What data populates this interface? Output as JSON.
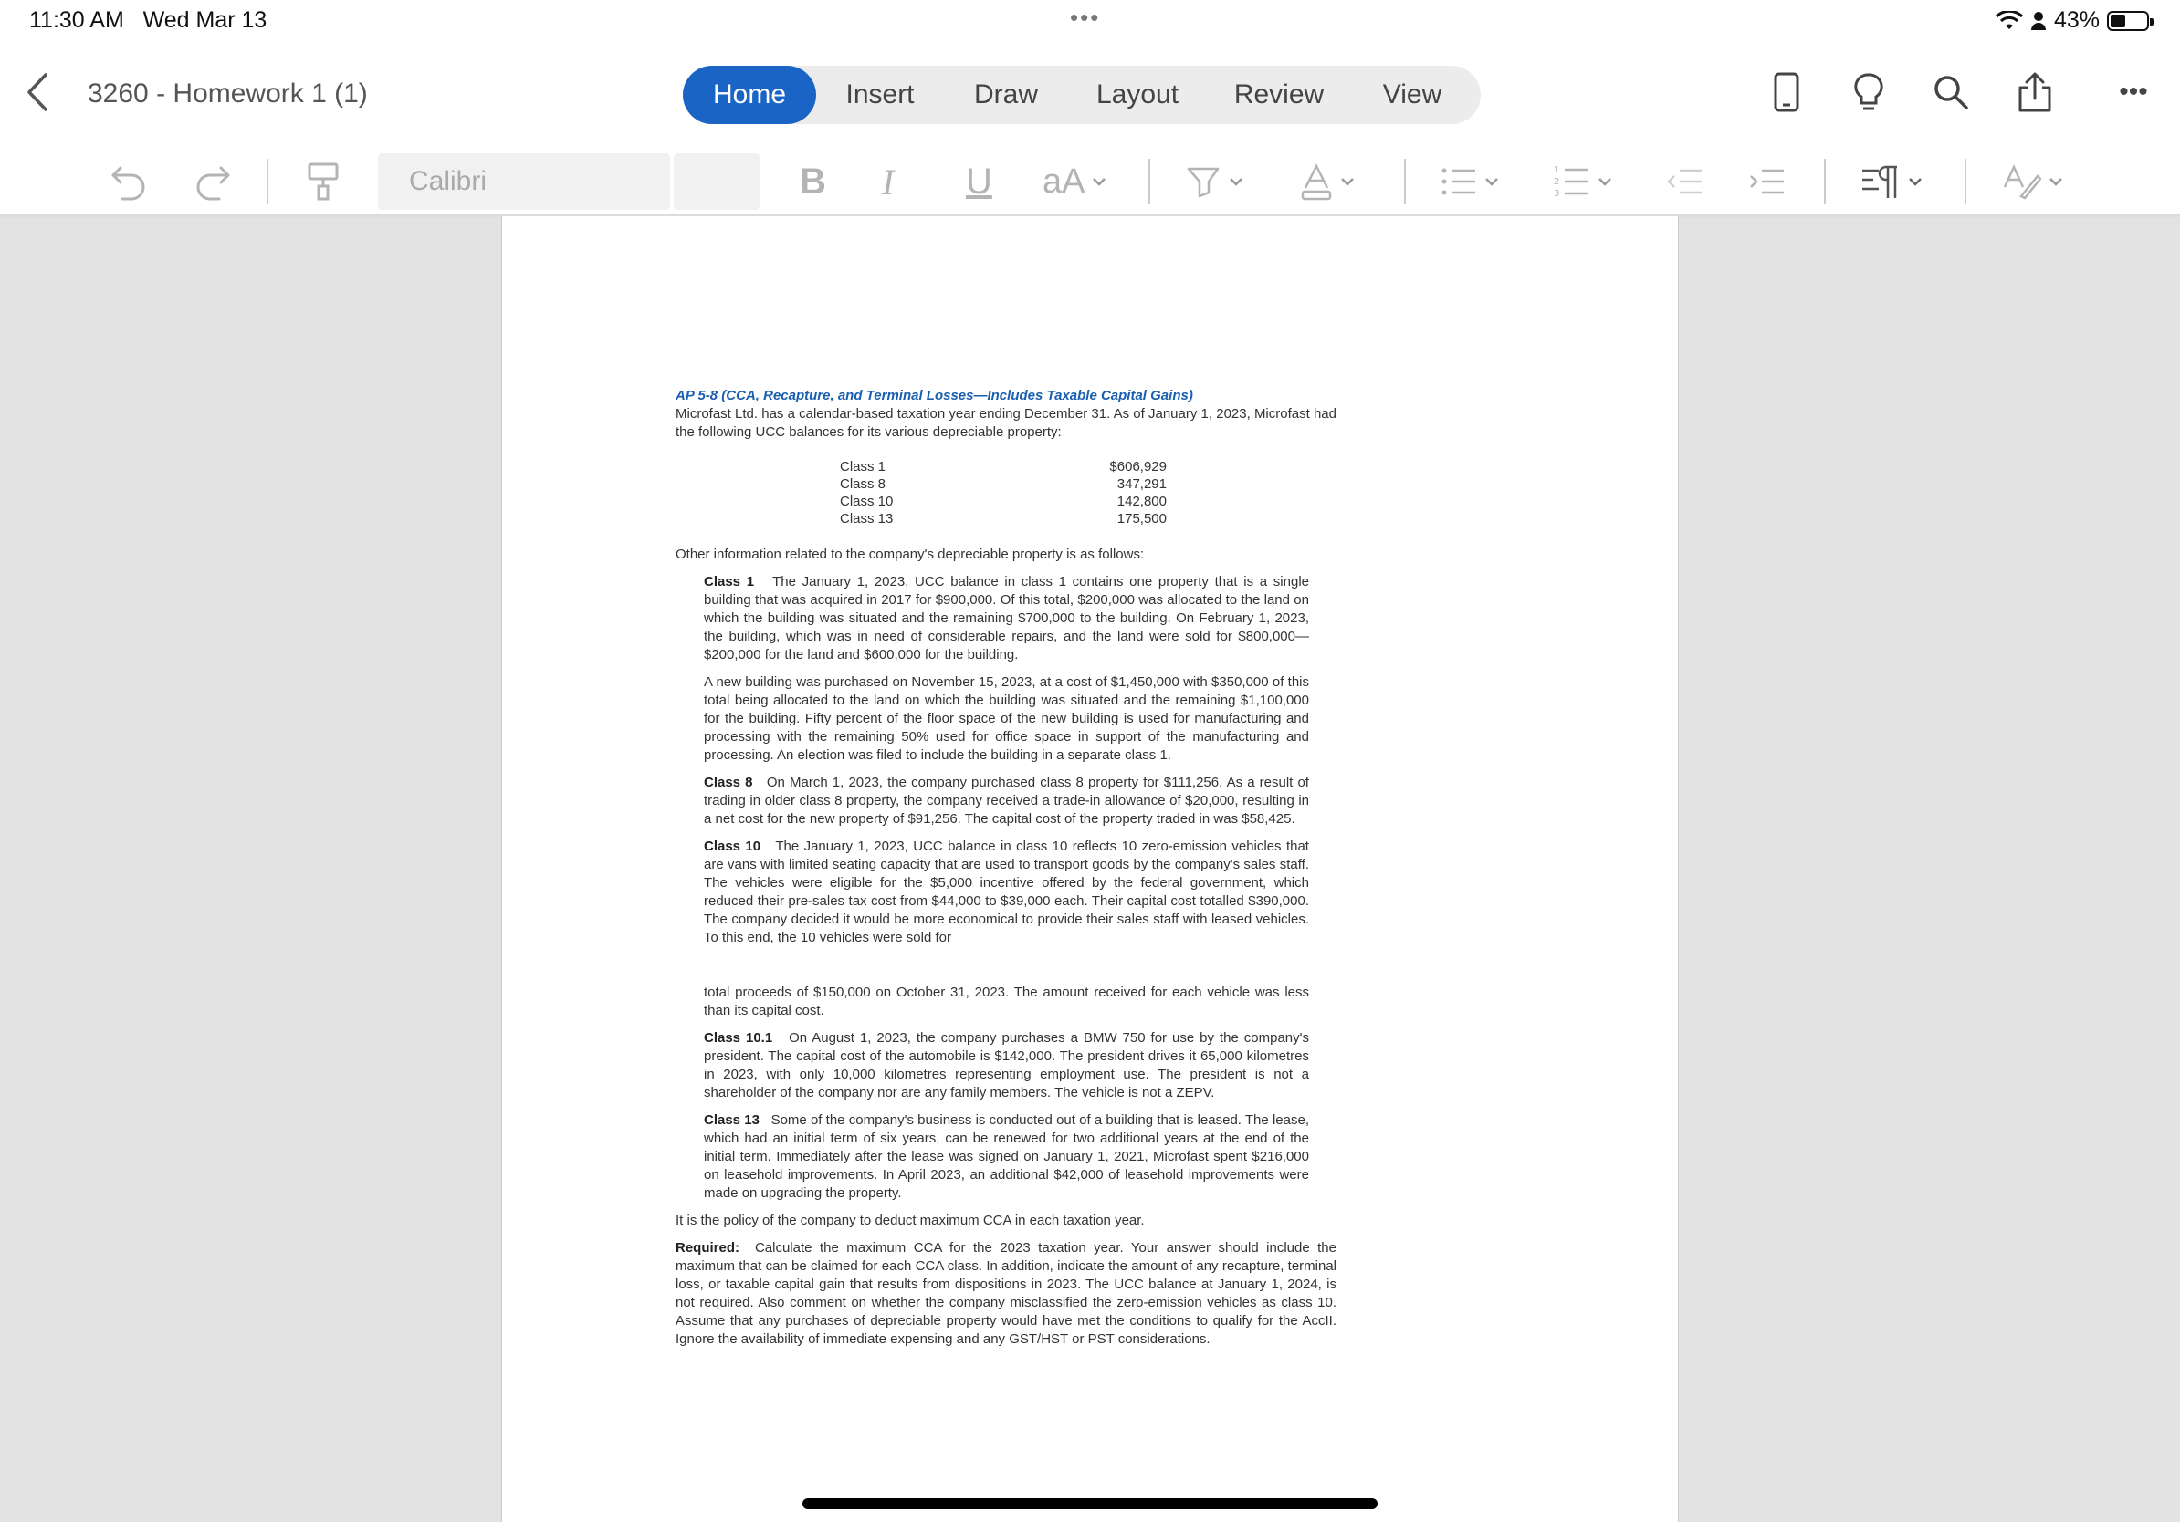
{
  "status": {
    "time": "11:30 AM",
    "date": "Wed Mar 13",
    "dots": "•••",
    "battery": "43%",
    "battery_level": 0.43
  },
  "titlebar": {
    "title": "3260 - Homework 1 (1)",
    "tabs": [
      {
        "label": "Home",
        "active": true
      },
      {
        "label": "Insert",
        "active": false
      },
      {
        "label": "Draw",
        "active": false
      },
      {
        "label": "Layout",
        "active": false
      },
      {
        "label": "Review",
        "active": false
      },
      {
        "label": "View",
        "active": false
      }
    ],
    "more": "•••"
  },
  "toolbar": {
    "font_name": "Calibri",
    "bold": "B",
    "italic": "I",
    "underline": "U",
    "font_size_label": "aA"
  },
  "colors": {
    "accent": "#1a64c5",
    "heading": "#1a5fae",
    "disabled": "#b4b4b4"
  },
  "document": {
    "heading": "AP 5-8   (CCA, Recapture, and Terminal Losses—Includes Taxable Capital Gains)",
    "intro": "Microfast Ltd. has a calendar-based taxation year ending December 31. As of January 1, 2023, Microfast had the following UCC balances for its various depreciable property:",
    "ucc_balances": [
      {
        "class": "Class 1",
        "amount": "$606,929"
      },
      {
        "class": "Class 8",
        "amount": "347,291"
      },
      {
        "class": "Class 10",
        "amount": "142,800"
      },
      {
        "class": "Class 13",
        "amount": "175,500"
      }
    ],
    "other_info": "Other information related to the company's depreciable property is as follows:",
    "class1_label": "Class 1",
    "class1_text": "The January 1, 2023, UCC balance in class 1 contains one property that is a single building that was acquired in 2017 for $900,000. Of this total, $200,000 was allocated to the land on which the building was situated and the remaining $700,000 to the building. On February 1, 2023, the building, which was in need of considerable repairs, and the land were sold for $800,000—$200,000 for the land and $600,000 for the building.",
    "class1_new_building": "A new building was purchased on November 15, 2023, at a cost of $1,450,000 with $350,000 of this total being allocated to the land on which the building was situated and the remaining $1,100,000 for the building. Fifty percent of the floor space of the new building is used for manufacturing and processing with the remaining 50% used for office space in support of the manufacturing and processing. An election was filed to include the building in a separate class 1.",
    "class8_label": "Class 8",
    "class8_text": "On March 1, 2023, the company purchased class 8 property for $111,256. As a result of trading in older class 8 property, the company received a trade-in allowance of $20,000, resulting in a net cost for the new property of $91,256. The capital cost of the property traded in was $58,425.",
    "class10_label": "Class 10",
    "class10_text": "The January 1, 2023, UCC balance in class 10 reflects 10 zero-emission vehicles that are vans with limited seating capacity that are used to transport goods by the company's sales staff. The vehicles were eligible for the $5,000 incentive offered by the federal government, which reduced their pre-sales tax cost from $44,000 to $39,000 each. Their capital cost totalled $390,000. The company decided it would be more economical to provide their sales staff with leased vehicles. To this end, the 10 vehicles were sold for",
    "class10_cont": "total proceeds of $150,000 on October 31, 2023. The amount received for each vehicle was less than its capital cost.",
    "class101_label": "Class 10.1",
    "class101_text": "On August 1, 2023, the company purchases a BMW 750 for use by the company's president. The capital cost of the automobile is $142,000. The president drives it 65,000 kilometres in 2023, with only 10,000 kilometres representing employment use. The president is not a shareholder of the company nor are any family members. The vehicle is not a ZEPV.",
    "class13_label": "Class 13",
    "class13_text": "Some of the company's business is conducted out of a building that is leased. The lease, which had an initial term of six years, can be renewed for two additional years at the end of the initial term. Immediately after the lease was signed on January 1, 2021, Microfast spent $216,000 on leasehold improvements. In April 2023, an additional $42,000 of leasehold improvements were made on upgrading the property.",
    "policy": "It is the policy of the company to deduct maximum CCA in each taxation year.",
    "required_label": "Required:",
    "required_text": "Calculate the maximum CCA for the 2023 taxation year. Your answer should include the maximum that can be claimed for each CCA class. In addition, indicate the amount of any recapture, terminal loss, or taxable capital gain that results from dispositions in 2023. The UCC balance at January 1, 2024, is not required. Also comment on whether the company misclassified the zero-emission vehicles as class 10. Assume that any purchases of depreciable property would have met the conditions to qualify for the AccII. Ignore the availability of immediate expensing and any GST/HST or PST considerations."
  }
}
